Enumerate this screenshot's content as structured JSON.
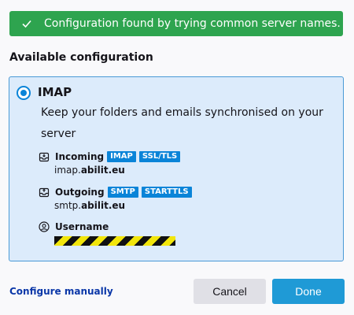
{
  "banner": {
    "icon": "checkmark-icon",
    "text": "Configuration found by trying common server names."
  },
  "section_title": "Available configuration",
  "config": {
    "selected": true,
    "protocol": "IMAP",
    "description": "Keep your folders and emails synchronised on your server",
    "incoming": {
      "icon": "incoming-mail-icon",
      "label": "Incoming",
      "badges": [
        "IMAP",
        "SSL/TLS"
      ],
      "host_prefix": "imap.",
      "host_domain": "abilit.eu"
    },
    "outgoing": {
      "icon": "outgoing-mail-icon",
      "label": "Outgoing",
      "badges": [
        "SMTP",
        "STARTTLS"
      ],
      "host_prefix": "smtp.",
      "host_domain": "abilit.eu"
    },
    "username": {
      "icon": "user-icon",
      "label": "Username"
    }
  },
  "actions": {
    "configure_manually": "Configure manually",
    "cancel": "Cancel",
    "done": "Done"
  },
  "colors": {
    "banner_bg": "#2ea44f",
    "accent": "#0a84d8",
    "card_bg": "#dcebfb",
    "link": "#0a37a8"
  }
}
